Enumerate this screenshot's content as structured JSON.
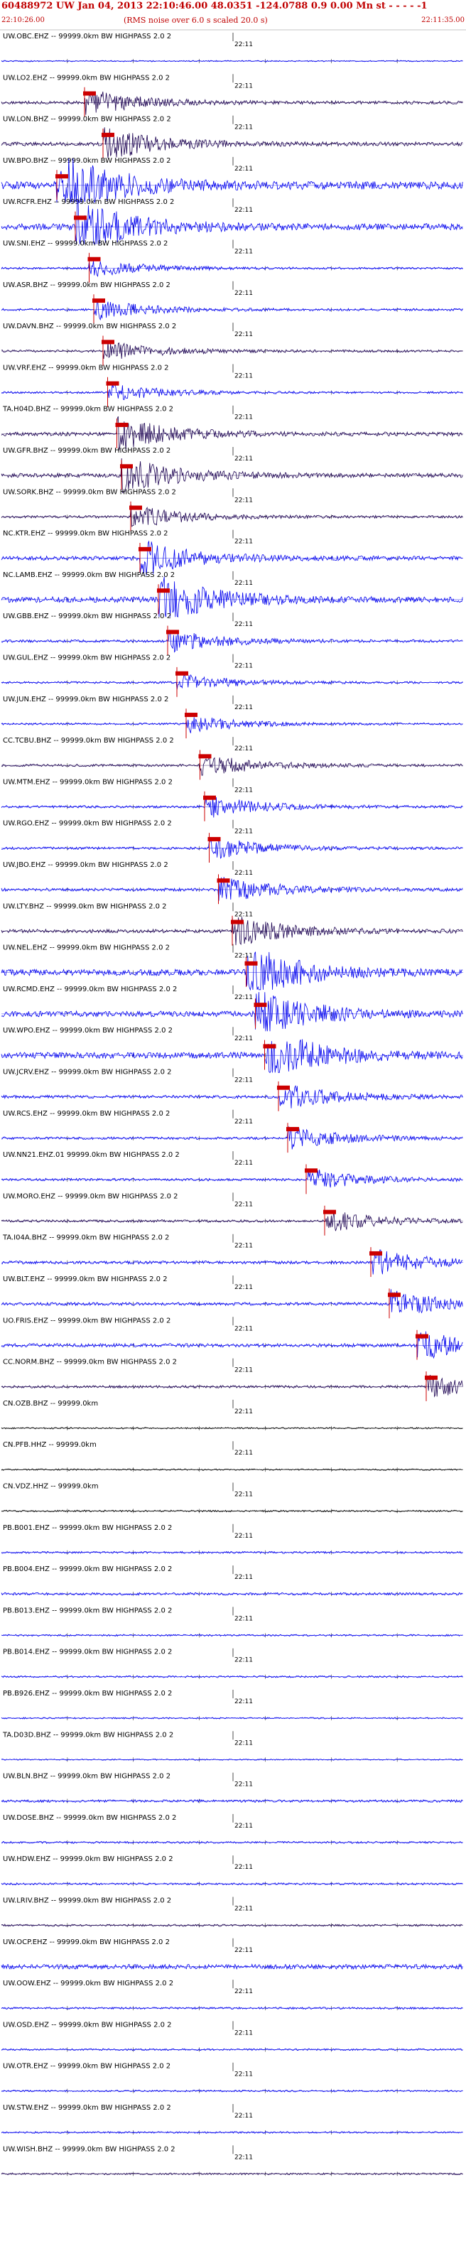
{
  "header": {
    "title": "60488972 UW Jan 04, 2013 22:10:46.00    48.0351  -124.0788  0.9 0.00  Mn st - - - -   -1",
    "subtitle": "(RMS noise over 6.0 s scaled 20.0 s)",
    "time_start": "22:10:26.00",
    "time_end": "22:11:35.00"
  },
  "tick_label": "22:11",
  "colors": {
    "trace_blue": "#0000ee",
    "trace_dark": "#1a0050",
    "trace_black": "#000000",
    "pick": "#cc0000"
  },
  "traces": [
    {
      "label": "UW.OBC.EHZ -- 99999.0km BW  HIGHPASS  2.0  2",
      "color": "blue",
      "amp": 0.5,
      "pick": null
    },
    {
      "label": "UW.LO2.EHZ -- 99999.0km BW  HIGHPASS  2.0  2",
      "color": "dark",
      "amp": 1.2,
      "pick": 0.18
    },
    {
      "label": "UW.LON.BHZ -- 99999.0km BW  HIGHPASS  2.0  2",
      "color": "dark",
      "amp": 1.5,
      "pick": 0.22
    },
    {
      "label": "UW.BPO.BHZ -- 99999.0km BW  HIGHPASS  2.0  2",
      "color": "blue",
      "amp": 3.0,
      "pick": 0.12
    },
    {
      "label": "UW.RCFR.EHZ -- 99999.0km BW  HIGHPASS  2.0  2",
      "color": "blue",
      "amp": 2.5,
      "pick": 0.16
    },
    {
      "label": "UW.SNI.EHZ -- 99999.0km BW  HIGHPASS  2.0  2",
      "color": "blue",
      "amp": 0.8,
      "pick": 0.19
    },
    {
      "label": "UW.ASR.BHZ -- 99999.0km BW  HIGHPASS  2.0  2",
      "color": "blue",
      "amp": 0.9,
      "pick": 0.2
    },
    {
      "label": "UW.DAVN.BHZ -- 99999.0km BW  HIGHPASS  2.0  2",
      "color": "dark",
      "amp": 0.9,
      "pick": 0.22
    },
    {
      "label": "UW.VRF.EHZ -- 99999.0km BW  HIGHPASS  2.0  2",
      "color": "blue",
      "amp": 0.8,
      "pick": 0.23
    },
    {
      "label": "TA.H04D.BHZ -- 99999.0km BW  HIGHPASS  2.0  2",
      "color": "dark",
      "amp": 1.5,
      "pick": 0.25
    },
    {
      "label": "UW.GFR.BHZ -- 99999.0km BW  HIGHPASS  2.0  2",
      "color": "dark",
      "amp": 1.6,
      "pick": 0.26
    },
    {
      "label": "UW.SORK.BHZ -- 99999.0km BW  HIGHPASS  2.0  2",
      "color": "dark",
      "amp": 1.0,
      "pick": 0.28
    },
    {
      "label": "NC.KTR.EHZ -- 99999.0km BW  HIGHPASS  2.0  2",
      "color": "blue",
      "amp": 1.6,
      "pick": 0.3
    },
    {
      "label": "NC.LAMB.EHZ -- 99999.0km BW  HIGHPASS  2.0  2",
      "color": "blue",
      "amp": 2.2,
      "pick": 0.34
    },
    {
      "label": "UW.GBB.EHZ -- 99999.0km BW  HIGHPASS  2.0  2",
      "color": "blue",
      "amp": 1.0,
      "pick": 0.36
    },
    {
      "label": "UW.GUL.EHZ -- 99999.0km BW  HIGHPASS  2.0  2",
      "color": "blue",
      "amp": 0.8,
      "pick": 0.38
    },
    {
      "label": "UW.JUN.EHZ -- 99999.0km BW  HIGHPASS  2.0  2",
      "color": "blue",
      "amp": 0.8,
      "pick": 0.4
    },
    {
      "label": "CC.TCBU.BHZ -- 99999.0km BW  HIGHPASS  2.0  2",
      "color": "dark",
      "amp": 1.0,
      "pick": 0.43
    },
    {
      "label": "UW.MTM.EHZ -- 99999.0km BW  HIGHPASS  2.0  2",
      "color": "blue",
      "amp": 1.0,
      "pick": 0.44
    },
    {
      "label": "UW.RGO.EHZ -- 99999.0km BW  HIGHPASS  2.0  2",
      "color": "blue",
      "amp": 1.0,
      "pick": 0.45
    },
    {
      "label": "UW.JBO.EHZ -- 99999.0km BW  HIGHPASS  2.0  2",
      "color": "blue",
      "amp": 1.2,
      "pick": 0.47
    },
    {
      "label": "UW.LTY.BHZ -- 99999.0km BW  HIGHPASS  2.0  2",
      "color": "dark",
      "amp": 1.4,
      "pick": 0.5
    },
    {
      "label": "UW.NEL.EHZ -- 99999.0km BW  HIGHPASS  2.0  2",
      "color": "blue",
      "amp": 2.4,
      "pick": 0.53
    },
    {
      "label": "UW.RCMD.EHZ -- 99999.0km BW  HIGHPASS  2.0  2",
      "color": "blue",
      "amp": 2.2,
      "pick": 0.55
    },
    {
      "label": "UW.WPO.EHZ -- 99999.0km BW  HIGHPASS  2.0  2",
      "color": "blue",
      "amp": 2.4,
      "pick": 0.57
    },
    {
      "label": "UW.JCRV.EHZ -- 99999.0km BW  HIGHPASS  2.0  2",
      "color": "blue",
      "amp": 1.2,
      "pick": 0.6
    },
    {
      "label": "UW.RCS.EHZ -- 99999.0km BW  HIGHPASS  2.0  2",
      "color": "blue",
      "amp": 1.0,
      "pick": 0.62
    },
    {
      "label": "UW.NN21.EHZ.01 99999.0km BW  HIGHPASS  2.0  2",
      "color": "blue",
      "amp": 1.0,
      "pick": 0.66
    },
    {
      "label": "UW.MORO.EHZ -- 99999.0km BW  HIGHPASS  2.0  2",
      "color": "dark",
      "amp": 1.0,
      "pick": 0.7
    },
    {
      "label": "TA.I04A.BHZ -- 99999.0km BW  HIGHPASS  2.0  2",
      "color": "blue",
      "amp": 1.2,
      "pick": 0.8
    },
    {
      "label": "UW.BLT.EHZ -- 99999.0km BW  HIGHPASS  2.0  2",
      "color": "blue",
      "amp": 1.2,
      "pick": 0.84
    },
    {
      "label": "UO.FRIS.EHZ -- 99999.0km BW  HIGHPASS  2.0  2",
      "color": "blue",
      "amp": 1.4,
      "pick": 0.9
    },
    {
      "label": "CC.NORM.BHZ -- 99999.0km BW  HIGHPASS  2.0  2",
      "color": "dark",
      "amp": 1.0,
      "pick": 0.92
    },
    {
      "label": "CN.OZB.BHZ -- 99999.0km",
      "color": "black",
      "amp": 0.6,
      "pick": null
    },
    {
      "label": "CN.PFB.HHZ -- 99999.0km",
      "color": "black",
      "amp": 0.6,
      "pick": null
    },
    {
      "label": "CN.VDZ.HHZ -- 99999.0km",
      "color": "black",
      "amp": 0.7,
      "pick": null
    },
    {
      "label": "PB.B001.EHZ -- 99999.0km BW  HIGHPASS  2.0  2",
      "color": "blue",
      "amp": 0.8,
      "pick": null
    },
    {
      "label": "PB.B004.EHZ -- 99999.0km BW  HIGHPASS  2.0  2",
      "color": "blue",
      "amp": 1.0,
      "pick": null
    },
    {
      "label": "PB.B013.EHZ -- 99999.0km BW  HIGHPASS  2.0  2",
      "color": "blue",
      "amp": 0.7,
      "pick": null
    },
    {
      "label": "PB.B014.EHZ -- 99999.0km BW  HIGHPASS  2.0  2",
      "color": "blue",
      "amp": 0.7,
      "pick": null
    },
    {
      "label": "PB.B926.EHZ -- 99999.0km BW  HIGHPASS  2.0  2",
      "color": "blue",
      "amp": 0.6,
      "pick": null
    },
    {
      "label": "TA.D03D.BHZ -- 99999.0km BW  HIGHPASS  2.0  2",
      "color": "blue",
      "amp": 0.5,
      "pick": null
    },
    {
      "label": "UW.BLN.BHZ -- 99999.0km BW  HIGHPASS  2.0  2",
      "color": "blue",
      "amp": 1.0,
      "pick": null
    },
    {
      "label": "UW.DOSE.BHZ -- 99999.0km BW  HIGHPASS  2.0  2",
      "color": "blue",
      "amp": 0.8,
      "pick": null
    },
    {
      "label": "UW.HDW.EHZ -- 99999.0km BW  HIGHPASS  2.0  2",
      "color": "blue",
      "amp": 0.8,
      "pick": null
    },
    {
      "label": "UW.LRIV.BHZ -- 99999.0km BW  HIGHPASS  2.0  2",
      "color": "dark",
      "amp": 0.8,
      "pick": null
    },
    {
      "label": "UW.OCP.EHZ -- 99999.0km BW  HIGHPASS  2.0  2",
      "color": "blue",
      "amp": 1.8,
      "pick": null
    },
    {
      "label": "UW.OOW.EHZ -- 99999.0km BW  HIGHPASS  2.0  2",
      "color": "blue",
      "amp": 0.8,
      "pick": null
    },
    {
      "label": "UW.OSD.EHZ -- 99999.0km BW  HIGHPASS  2.0  2",
      "color": "blue",
      "amp": 0.7,
      "pick": null
    },
    {
      "label": "UW.OTR.EHZ -- 99999.0km BW  HIGHPASS  2.0  2",
      "color": "blue",
      "amp": 0.7,
      "pick": null
    },
    {
      "label": "UW.STW.EHZ -- 99999.0km BW  HIGHPASS  2.0  2",
      "color": "blue",
      "amp": 0.7,
      "pick": null
    },
    {
      "label": "UW.WISH.BHZ -- 99999.0km BW  HIGHPASS  2.0  2",
      "color": "dark",
      "amp": 0.7,
      "pick": null
    }
  ]
}
